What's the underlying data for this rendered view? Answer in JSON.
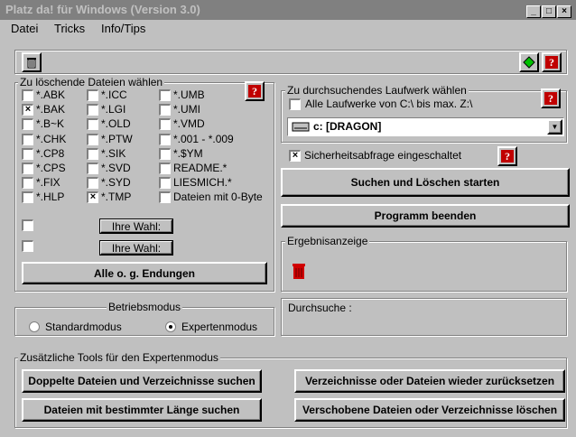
{
  "window": {
    "title": "Platz da! für Windows (Version 3.0)"
  },
  "menu": {
    "file": "Datei",
    "tricks": "Tricks",
    "info": "Info/Tips"
  },
  "files": {
    "legend": "Zu löschende Dateien wählen",
    "col1": [
      {
        "label": "*.ABK",
        "checked": false
      },
      {
        "label": "*.BAK",
        "checked": true
      },
      {
        "label": "*.B~K",
        "checked": false
      },
      {
        "label": "*.CHK",
        "checked": false
      },
      {
        "label": "*.CP8",
        "checked": false
      },
      {
        "label": "*.CPS",
        "checked": false
      },
      {
        "label": "*.FIX",
        "checked": false
      },
      {
        "label": "*.HLP",
        "checked": false
      }
    ],
    "col2": [
      {
        "label": "*.ICC",
        "checked": false
      },
      {
        "label": "*.LGI",
        "checked": false
      },
      {
        "label": "*.OLD",
        "checked": false
      },
      {
        "label": "*.PTW",
        "checked": false
      },
      {
        "label": "*.SIK",
        "checked": false
      },
      {
        "label": "*.SVD",
        "checked": false
      },
      {
        "label": "*.SYD",
        "checked": false
      },
      {
        "label": "*.TMP",
        "checked": true
      }
    ],
    "col3": [
      {
        "label": "*.UMB",
        "checked": false
      },
      {
        "label": "*.UMI",
        "checked": false
      },
      {
        "label": "*.VMD",
        "checked": false
      },
      {
        "label": "*.001 - *.009",
        "checked": false
      },
      {
        "label": "*.$YM",
        "checked": false
      },
      {
        "label": "README.*",
        "checked": false
      },
      {
        "label": "LIESMICH.*",
        "checked": false
      },
      {
        "label": "Dateien mit 0-Byte",
        "checked": false
      }
    ],
    "custom1_label": "Ihre Wahl:",
    "custom2_label": "Ihre Wahl:",
    "all_button": "Alle o. g. Endungen"
  },
  "drive": {
    "legend": "Zu durchsuchendes Laufwerk wählen",
    "all_drives_label": "Alle Laufwerke von C:\\ bis max. Z:\\",
    "selected": "c: [DRAGON]"
  },
  "safety_label": "Sicherheitsabfrage eingeschaltet",
  "search_button": "Suchen und Löschen starten",
  "exit_button": "Programm beenden",
  "results": {
    "legend": "Ergebnisanzeige"
  },
  "mode": {
    "legend": "Betriebsmodus",
    "standard": "Standardmodus",
    "expert": "Expertenmodus",
    "selected": "expert"
  },
  "search_status": {
    "label": "Durchsuche :"
  },
  "tools": {
    "legend": "Zusätzliche Tools für den Expertenmodus",
    "duplicates": "Doppelte Dateien und Verzeichnisse suchen",
    "restore": "Verzeichnisse oder Dateien wieder zurücksetzen",
    "length": "Dateien mit bestimmter Länge suchen",
    "moved": "Verschobene Dateien oder Verzeichnisse löschen"
  },
  "help_glyph": "?"
}
